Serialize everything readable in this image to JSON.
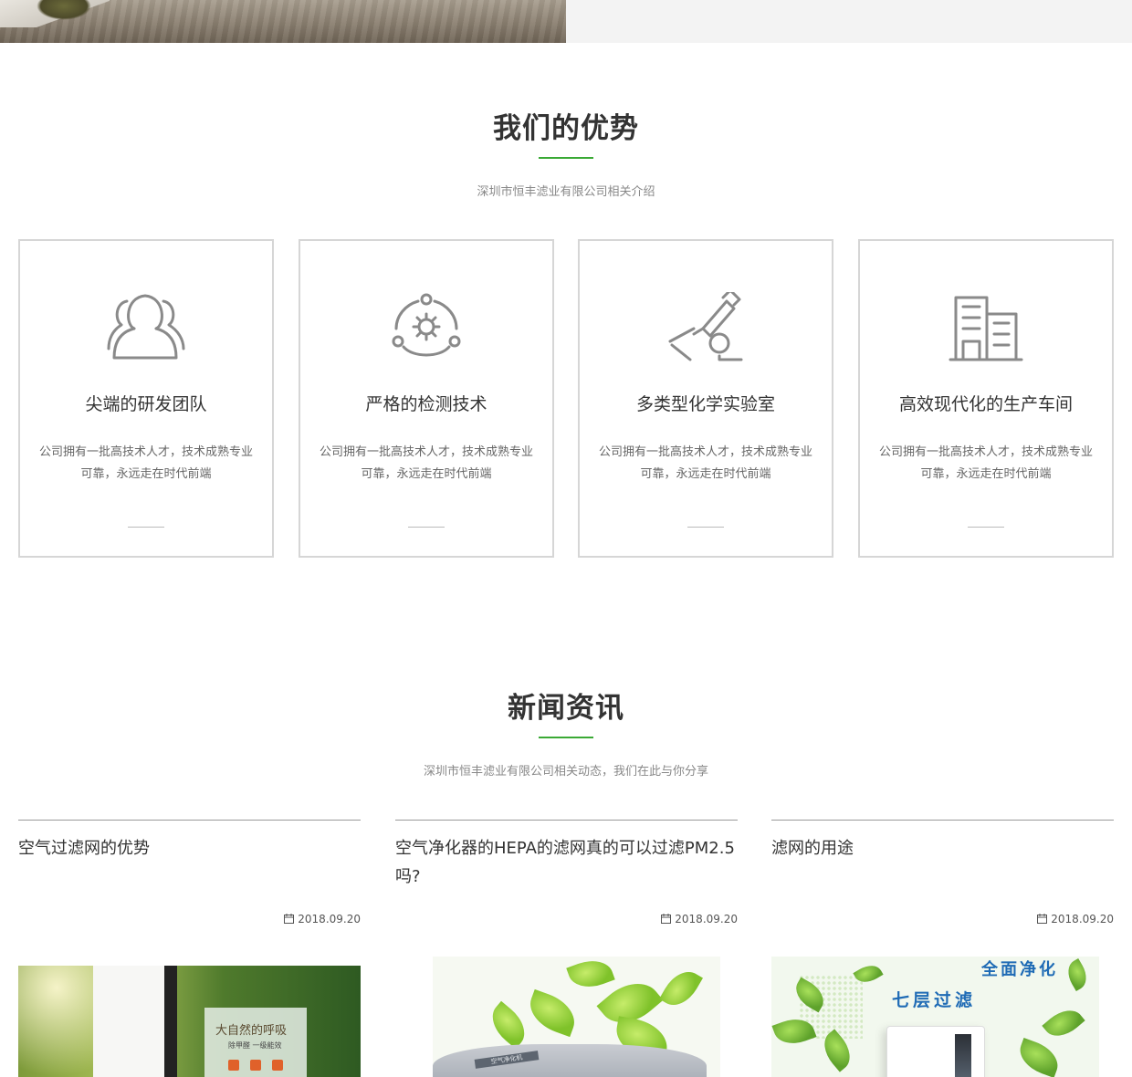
{
  "advantages": {
    "title": "我们的优势",
    "subtitle": "深圳市恒丰滤业有限公司相关介绍",
    "cards": [
      {
        "icon": "team-icon",
        "title": "尖端的研发团队",
        "desc_line1": "公司拥有一批高技术人才，技术成熟专业",
        "desc_line2": "可靠，永远走在时代前端"
      },
      {
        "icon": "gear-cycle-icon",
        "title": "严格的检测技术",
        "desc_line1": "公司拥有一批高技术人才，技术成熟专业",
        "desc_line2": "可靠，永远走在时代前端"
      },
      {
        "icon": "microscope-icon",
        "title": "多类型化学实验室",
        "desc_line1": "公司拥有一批高技术人才，技术成熟专业",
        "desc_line2": "可靠，永远走在时代前端"
      },
      {
        "icon": "building-icon",
        "title": "高效现代化的生产车间",
        "desc_line1": "公司拥有一批高技术人才，技术成熟专业",
        "desc_line2": "可靠，永远走在时代前端"
      }
    ]
  },
  "news": {
    "title": "新闻资讯",
    "subtitle": "深圳市恒丰滤业有限公司相关动态，我们在此与你分享",
    "items": [
      {
        "title": "空气过滤网的优势",
        "date": "2018.09.20"
      },
      {
        "title": "空气净化器的HEPA的滤网真的可以过滤PM2.5吗?",
        "date": "2018.09.20"
      },
      {
        "title": "滤网的用途",
        "date": "2018.09.20"
      }
    ],
    "thumb1_text1": "大自然的呼吸",
    "thumb1_text2": "除甲醛 一级能效",
    "thumb2_label": "空气净化机",
    "thumb3_text1": "全面净化",
    "thumb3_text2": "七层过滤"
  },
  "colors": {
    "accent": "#3aa935",
    "border": "#d6d6d6",
    "icon": "#8a8a8a"
  }
}
